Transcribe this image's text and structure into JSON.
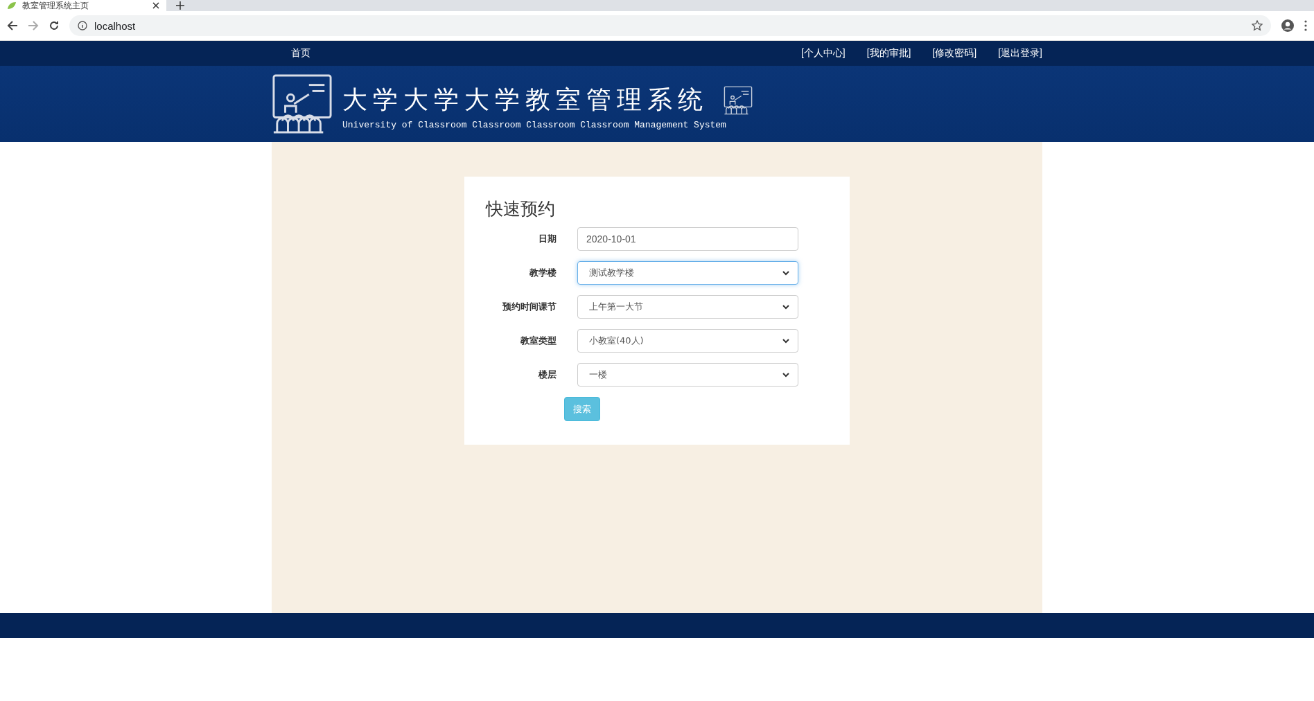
{
  "browser": {
    "tab_title": "教室管理系统主页",
    "address": "localhost"
  },
  "nav": {
    "home": "首页",
    "links": [
      "[个人中心]",
      "[我的审批]",
      "[修改密码]",
      "[退出登录]"
    ]
  },
  "header": {
    "title": "大学大学大学教室管理系统",
    "subtitle": "University of Classroom Classroom Classroom Classroom Management System"
  },
  "form": {
    "title": "快速预约",
    "fields": [
      {
        "label": "日期",
        "kind": "input",
        "value": "2020-10-01",
        "focused": false
      },
      {
        "label": "教学楼",
        "kind": "select",
        "value": "测试教学楼",
        "focused": true
      },
      {
        "label": "预约时间课节",
        "kind": "select",
        "value": "上午第一大节",
        "focused": false
      },
      {
        "label": "教室类型",
        "kind": "select",
        "value": "小教室(40人)",
        "focused": false
      },
      {
        "label": "楼层",
        "kind": "select",
        "value": "一楼",
        "focused": false
      }
    ],
    "button": "搜索"
  }
}
